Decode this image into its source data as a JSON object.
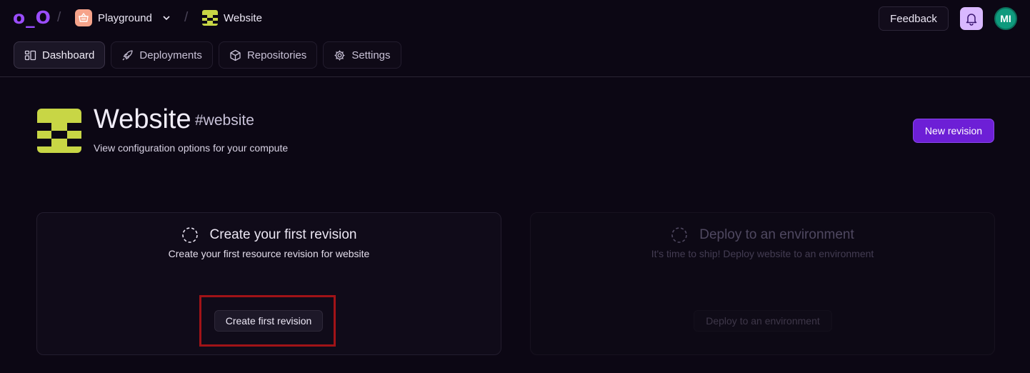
{
  "app": {
    "logo_text": "o_O"
  },
  "breadcrumb": {
    "project": "Playground",
    "resource": "Website"
  },
  "header_actions": {
    "feedback_label": "Feedback",
    "avatar_initials": "MI"
  },
  "nav": {
    "tabs": [
      {
        "label": "Dashboard",
        "icon": "dashboard-icon",
        "active": true
      },
      {
        "label": "Deployments",
        "icon": "rocket-icon",
        "active": false
      },
      {
        "label": "Repositories",
        "icon": "box-icon",
        "active": false
      },
      {
        "label": "Settings",
        "icon": "gear-icon",
        "active": false
      }
    ]
  },
  "page": {
    "title": "Website",
    "slug": "#website",
    "subtitle": "View configuration options for your compute",
    "new_revision_label": "New revision"
  },
  "cards": {
    "revision": {
      "title": "Create your first revision",
      "description": "Create your first resource revision for website",
      "button_label": "Create first revision"
    },
    "deploy": {
      "title": "Deploy to an environment",
      "description": "It's time to ship! Deploy website to an environment",
      "button_label": "Deploy to an environment"
    }
  },
  "colors": {
    "background": "#0c0714",
    "accent": "#6d1fd6",
    "logo": "#9b4dff",
    "site_icon": "#c8d645",
    "highlight": "#a11317",
    "avatar": "#0f9a7d"
  }
}
